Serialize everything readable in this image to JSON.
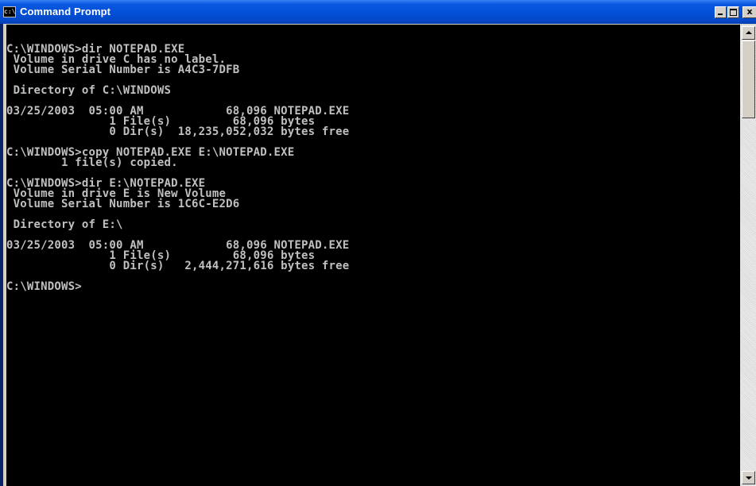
{
  "window": {
    "title": "Command Prompt",
    "icon_name": "console-icon",
    "icon_glyph": "c:\\"
  },
  "console": {
    "background_color": "#000000",
    "text_color": "#c0c0c0",
    "lines": [
      "C:\\WINDOWS>dir NOTEPAD.EXE",
      " Volume in drive C has no label.",
      " Volume Serial Number is A4C3-7DFB",
      "",
      " Directory of C:\\WINDOWS",
      "",
      "03/25/2003  05:00 AM            68,096 NOTEPAD.EXE",
      "               1 File(s)         68,096 bytes",
      "               0 Dir(s)  18,235,052,032 bytes free",
      "",
      "C:\\WINDOWS>copy NOTEPAD.EXE E:\\NOTEPAD.EXE",
      "        1 file(s) copied.",
      "",
      "C:\\WINDOWS>dir E:\\NOTEPAD.EXE",
      " Volume in drive E is New Volume",
      " Volume Serial Number is 1C6C-E2D6",
      "",
      " Directory of E:\\",
      "",
      "03/25/2003  05:00 AM            68,096 NOTEPAD.EXE",
      "               1 File(s)         68,096 bytes",
      "               0 Dir(s)   2,444,271,616 bytes free",
      "",
      "C:\\WINDOWS>"
    ]
  },
  "controls": {
    "minimize_icon": "minimize-icon",
    "maximize_icon": "maximize-icon",
    "close_icon": "close-icon",
    "close_glyph": "x"
  },
  "colors": {
    "titlebar": "#0450d8",
    "title_text": "#ffffff",
    "chrome": "#d4d0c8"
  }
}
